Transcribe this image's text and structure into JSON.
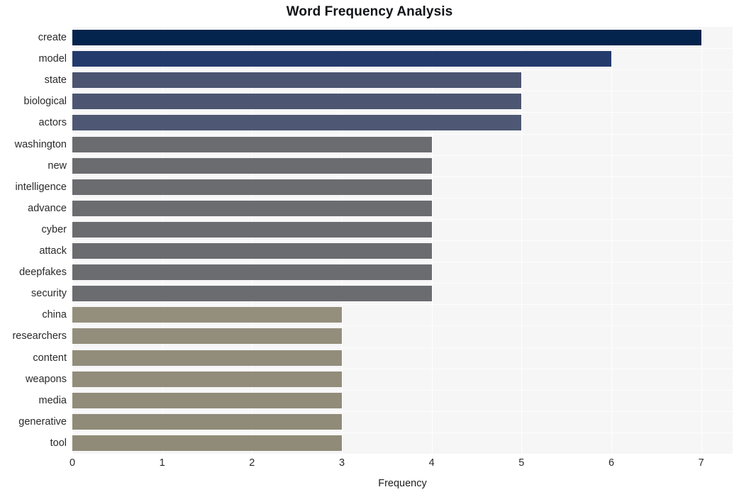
{
  "chart_data": {
    "type": "bar",
    "orientation": "horizontal",
    "title": "Word Frequency Analysis",
    "xlabel": "Frequency",
    "ylabel": "",
    "xlim": [
      0,
      7.35
    ],
    "xticks": [
      0,
      1,
      2,
      3,
      4,
      5,
      6,
      7
    ],
    "xtick_labels": [
      "0",
      "1",
      "2",
      "3",
      "4",
      "5",
      "6",
      "7"
    ],
    "grid": true,
    "grid_axis": "x",
    "legend": false,
    "plot_background": "#f6f6f7",
    "gridline_color": "#ffffff",
    "categories": [
      "create",
      "model",
      "state",
      "biological",
      "actors",
      "washington",
      "new",
      "intelligence",
      "advance",
      "cyber",
      "attack",
      "deepfakes",
      "security",
      "china",
      "researchers",
      "content",
      "weapons",
      "media",
      "generative",
      "tool"
    ],
    "values": [
      7,
      6,
      5,
      5,
      5,
      4,
      4,
      4,
      4,
      4,
      4,
      4,
      4,
      3,
      3,
      3,
      3,
      3,
      3,
      3
    ],
    "bar_colors": [
      "#04244d",
      "#233a6c",
      "#4b5470",
      "#4c5672",
      "#4e5874",
      "#6b6c70",
      "#6b6c70",
      "#6b6c70",
      "#6b6c70",
      "#6b6c70",
      "#6b6c70",
      "#6b6c70",
      "#6b6c70",
      "#948f7d",
      "#938e7c",
      "#928d7b",
      "#928d7a",
      "#918c79",
      "#908b78",
      "#908b78"
    ]
  }
}
